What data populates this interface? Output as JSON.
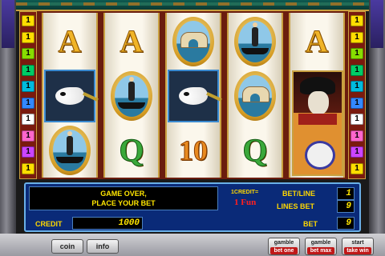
{
  "line_markers": {
    "left": [
      {
        "num": "1",
        "color": "#ffdd00"
      },
      {
        "num": "1",
        "color": "#ffdd00"
      },
      {
        "num": "1",
        "color": "#88dd00"
      },
      {
        "num": "1",
        "color": "#00cc66"
      },
      {
        "num": "1",
        "color": "#00bbdd"
      },
      {
        "num": "1",
        "color": "#3388ff"
      },
      {
        "num": "1",
        "color": "#ffffff"
      },
      {
        "num": "1",
        "color": "#ff66cc"
      },
      {
        "num": "1",
        "color": "#cc44ff"
      },
      {
        "num": "1",
        "color": "#ffdd00"
      }
    ],
    "right": [
      {
        "num": "1",
        "color": "#ffdd00"
      },
      {
        "num": "1",
        "color": "#ffdd00"
      },
      {
        "num": "1",
        "color": "#88dd00"
      },
      {
        "num": "1",
        "color": "#00cc66"
      },
      {
        "num": "1",
        "color": "#00bbdd"
      },
      {
        "num": "1",
        "color": "#3388ff"
      },
      {
        "num": "1",
        "color": "#ffffff"
      },
      {
        "num": "1",
        "color": "#ff66cc"
      },
      {
        "num": "1",
        "color": "#cc44ff"
      },
      {
        "num": "1",
        "color": "#ffdd00"
      }
    ]
  },
  "reels": [
    [
      {
        "symbol": "A",
        "icon": "letter-a-symbol"
      },
      {
        "symbol": "",
        "icon": "mask-symbol"
      },
      {
        "symbol": "",
        "icon": "gondolier-symbol"
      }
    ],
    [
      {
        "symbol": "A",
        "icon": "letter-a-symbol"
      },
      {
        "symbol": "",
        "icon": "gondolier-symbol"
      },
      {
        "symbol": "Q",
        "icon": "letter-q-symbol"
      }
    ],
    [
      {
        "symbol": "",
        "icon": "rialto-bridge-symbol"
      },
      {
        "symbol": "",
        "icon": "mask-symbol"
      },
      {
        "symbol": "10",
        "icon": "ten-symbol"
      }
    ],
    [
      {
        "symbol": "",
        "icon": "gondolier-symbol"
      },
      {
        "symbol": "",
        "icon": "rialto-bridge-symbol"
      },
      {
        "symbol": "Q",
        "icon": "letter-q-symbol"
      }
    ],
    [
      {
        "symbol": "A",
        "icon": "letter-a-symbol"
      },
      {
        "symbol": "",
        "icon": "venetian-couple-symbol"
      },
      {
        "symbol": "",
        "icon": "venetian-couple-symbol"
      }
    ]
  ],
  "panel": {
    "message_line1": "GAME OVER,",
    "message_line2": "PLACE YOUR BET",
    "credit_rate_label": "1CREDIT=",
    "credit_rate_value": "1 Fun",
    "bet_line_label": "BET/LINE",
    "bet_line_value": "1",
    "lines_bet_label": "LINES BET",
    "lines_bet_value": "9",
    "credit_label": "CREDIT",
    "credit_value": "1000",
    "bet_label": "BET",
    "bet_value": "9"
  },
  "buttons": {
    "coin": "coin",
    "info": "info",
    "gamble_bet_one_top": "gamble",
    "gamble_bet_one_bottom": "bet one",
    "gamble_bet_max_top": "gamble",
    "gamble_bet_max_bottom": "bet max",
    "start_top": "start",
    "start_bottom": "take win"
  },
  "colors": {
    "panel_bg": "#0a2a78",
    "text_yellow": "#ffd800",
    "reel_frame": "#6b1d0e",
    "gold": "#c9a040"
  }
}
